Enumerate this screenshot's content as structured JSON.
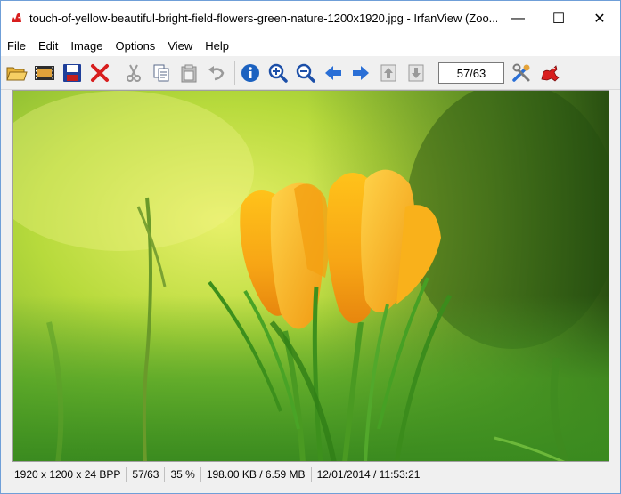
{
  "window": {
    "title": "touch-of-yellow-beautiful-bright-field-flowers-green-nature-1200x1920.jpg - IrfanView (Zoo...",
    "minimize_glyph": "—",
    "maximize_glyph": "☐",
    "close_glyph": "✕"
  },
  "menu": {
    "items": [
      "File",
      "Edit",
      "Image",
      "Options",
      "View",
      "Help"
    ]
  },
  "toolbar": {
    "icons": [
      "open-folder-icon",
      "slideshow-icon",
      "save-icon",
      "delete-icon",
      "cut-icon",
      "copy-icon",
      "paste-icon",
      "undo-icon",
      "info-icon",
      "zoom-in-icon",
      "zoom-out-icon",
      "previous-icon",
      "next-icon",
      "first-page-icon",
      "last-page-icon",
      "properties-icon",
      "irfanview-logo-icon"
    ],
    "file_counter": "57/63"
  },
  "status": {
    "dimensions": "1920 x 1200 x 24 BPP",
    "index": "57/63",
    "zoom": "35 %",
    "size": "198.00 KB / 6.59 MB",
    "datetime": "12/01/2014 / 11:53:21"
  },
  "colors": {
    "accent": "#1c62c0",
    "delete_red": "#d81e1e",
    "flower_orange": "#f7a515",
    "grass_green": "#3a8a1f"
  }
}
